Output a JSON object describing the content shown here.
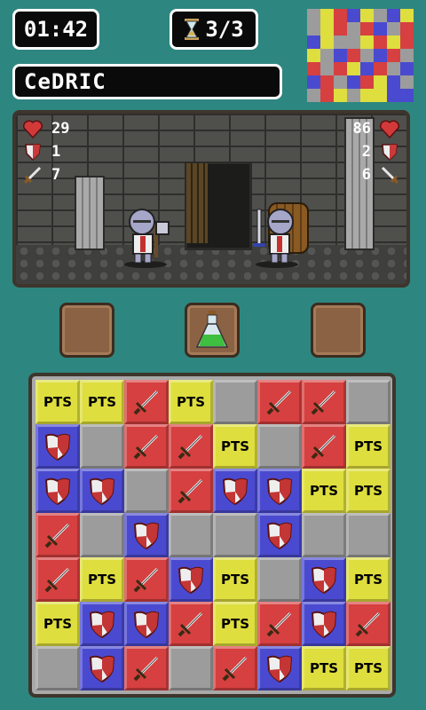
{
  "header": {
    "timer": "01:42",
    "turns": "3/3",
    "player_name": "CeDRIC"
  },
  "icons": {
    "hourglass": "hourglass-icon",
    "heart": "heart-icon",
    "shield": "shield-icon",
    "sword": "sword-icon",
    "potion": "potion-icon"
  },
  "player_stats": {
    "hp": "29",
    "defense": "1",
    "attack": "7"
  },
  "enemy_stats": {
    "hp": "86",
    "defense": "2",
    "attack": "6"
  },
  "inventory": [
    "empty",
    "green-potion",
    "empty"
  ],
  "tile_label": "PTS",
  "colors": {
    "pts": "#dede3f",
    "sword": "#d64040",
    "shield": "#4a4ad0",
    "empty": "#9c9c9c",
    "background": "#2e8680"
  },
  "board": [
    [
      "pts",
      "pts",
      "sword",
      "pts",
      "empty",
      "sword",
      "sword",
      "empty"
    ],
    [
      "shield",
      "empty",
      "sword",
      "sword",
      "pts",
      "empty",
      "sword",
      "pts"
    ],
    [
      "shield",
      "shield",
      "empty",
      "sword",
      "shield",
      "shield",
      "pts",
      "pts"
    ],
    [
      "sword",
      "empty",
      "shield",
      "empty",
      "empty",
      "shield",
      "empty",
      "empty"
    ],
    [
      "sword",
      "pts",
      "sword",
      "shield",
      "pts",
      "empty",
      "shield",
      "pts"
    ],
    [
      "pts",
      "shield",
      "shield",
      "sword",
      "pts",
      "sword",
      "shield",
      "sword"
    ],
    [
      "empty",
      "shield",
      "sword",
      "empty",
      "sword",
      "shield",
      "pts",
      "pts"
    ]
  ],
  "minimap": [
    [
      "empty",
      "pts",
      "sword",
      "shield",
      "pts",
      "empty",
      "shield",
      "pts"
    ],
    [
      "empty",
      "pts",
      "sword",
      "empty",
      "sword",
      "shield",
      "empty",
      "sword"
    ],
    [
      "shield",
      "pts",
      "empty",
      "empty",
      "pts",
      "sword",
      "pts",
      "sword"
    ],
    [
      "pts",
      "empty",
      "shield",
      "sword",
      "empty",
      "shield",
      "sword",
      "empty"
    ],
    [
      "sword",
      "empty",
      "sword",
      "pts",
      "shield",
      "sword",
      "empty",
      "shield"
    ],
    [
      "shield",
      "sword",
      "empty",
      "shield",
      "sword",
      "pts",
      "shield",
      "empty"
    ],
    [
      "empty",
      "sword",
      "pts",
      "empty",
      "pts",
      "pts",
      "shield",
      "shield"
    ]
  ]
}
